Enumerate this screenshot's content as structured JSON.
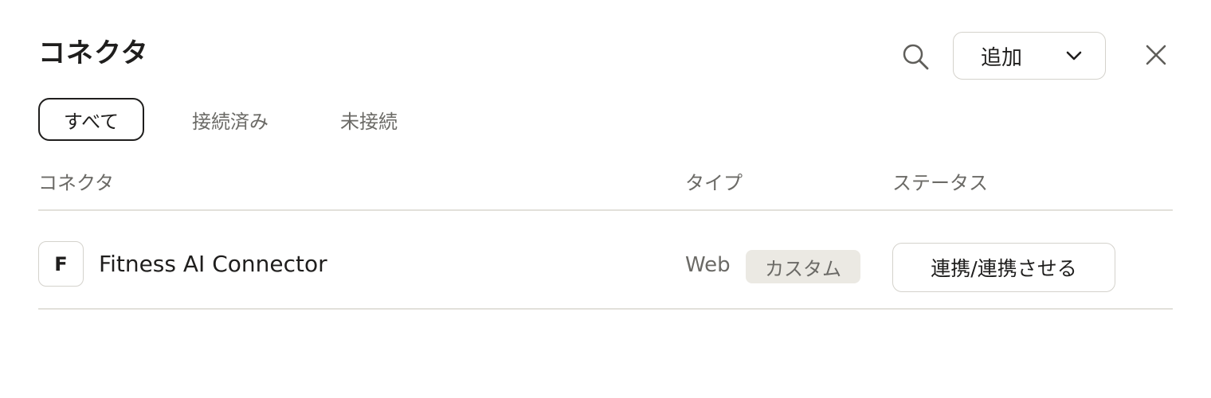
{
  "header": {
    "title": "コネクタ",
    "add_label": "追加"
  },
  "tabs": [
    {
      "label": "すべて",
      "active": true
    },
    {
      "label": "接続済み",
      "active": false
    },
    {
      "label": "未接続",
      "active": false
    }
  ],
  "table": {
    "columns": [
      "コネクタ",
      "タイプ",
      "ステータス"
    ],
    "rows": [
      {
        "avatar_letter": "F",
        "name": "Fitness AI Connector",
        "type": "Web",
        "badge": "カスタム",
        "status_action": "連携/連携させる"
      }
    ]
  },
  "icons": {
    "search": "search-icon",
    "add_dropdown": "chevron-down-icon",
    "close": "close-icon"
  },
  "colors": {
    "text_primary": "#1f1e1d",
    "text_secondary": "#6b6a66",
    "border": "#d4d2cc",
    "badge_bg": "#ebe9e3"
  }
}
